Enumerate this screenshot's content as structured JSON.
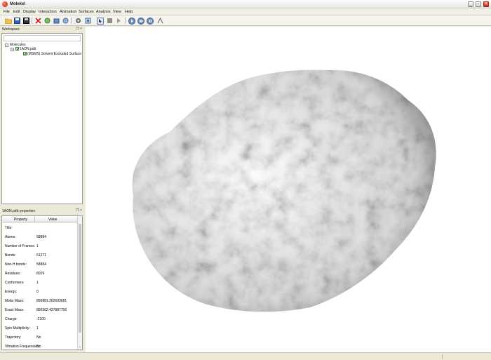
{
  "window": {
    "title": "Molekel"
  },
  "menu": [
    "File",
    "Edit",
    "Display",
    "Interaction",
    "Animation",
    "Surfaces",
    "Analysis",
    "View",
    "Help"
  ],
  "toolbar": {
    "icons": [
      "open-folder-icon",
      "save-icon",
      "save-as-icon",
      "close-molecule-icon",
      "refresh-icon",
      "render-icon",
      "snapshot-icon",
      "settings-icon",
      "fit-view-icon",
      "select-icon",
      "stop-icon",
      "play-icon",
      "forward-icon",
      "next-icon",
      "measure-icon"
    ]
  },
  "workspace": {
    "title": "Workspace",
    "tree": {
      "root": "Molecules",
      "molecule": "1AON.pdb",
      "surface": "(MSMS) Solvent Excluded Surface"
    }
  },
  "properties": {
    "title": "1AON.pdb properties",
    "columns": {
      "property": "Property",
      "value": "Value"
    },
    "rows": [
      {
        "name": "Title:",
        "value": ""
      },
      {
        "name": "Atoms:",
        "value": "58884"
      },
      {
        "name": "Number of Frames:",
        "value": "1"
      },
      {
        "name": "Bonds:",
        "value": "51271"
      },
      {
        "name": "Non-H bonds:",
        "value": "58884"
      },
      {
        "name": "Residues:",
        "value": "8029"
      },
      {
        "name": "Conformers:",
        "value": "1"
      },
      {
        "name": "Energy:",
        "value": "0"
      },
      {
        "name": "Molar Mass:",
        "value": "856881.262693681"
      },
      {
        "name": "Exact Mass:",
        "value": "856362.427887756"
      },
      {
        "name": "Charge:",
        "value": "-2100"
      },
      {
        "name": "Spin Multiplicity:",
        "value": "1"
      },
      {
        "name": "Trajectory:",
        "value": "No"
      },
      {
        "name": "Vibration Frequencies:",
        "value": "No"
      }
    ]
  },
  "colors": {
    "accent_close": "#c42f1f",
    "surface_gray": "#8a8a8a"
  }
}
